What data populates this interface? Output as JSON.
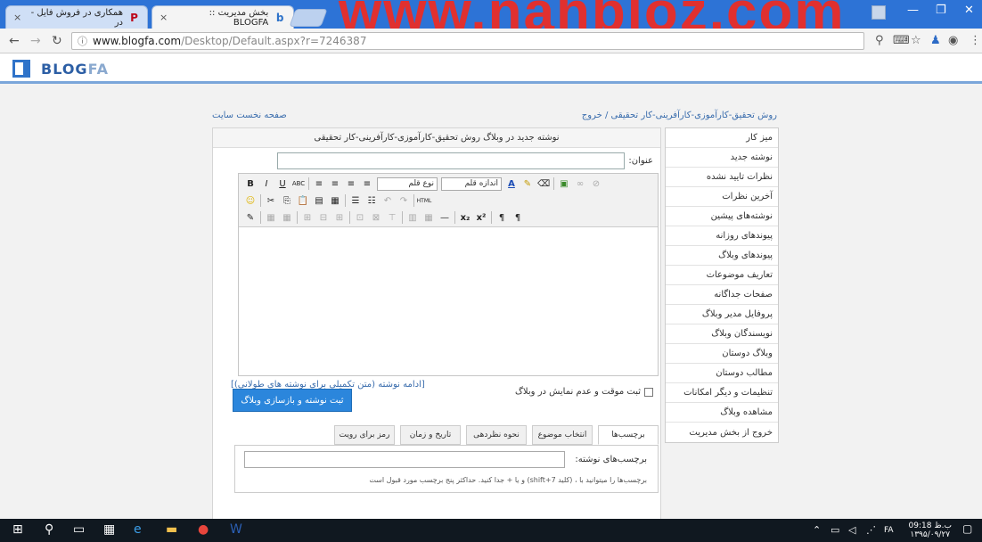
{
  "browser": {
    "tabs": [
      {
        "title": "همکاری در فروش فایل - در",
        "icon": "P"
      },
      {
        "title": "بخش مدیریت :: BLOGFA",
        "icon": "b"
      }
    ],
    "close_symbol": "×",
    "watermark": "www.nahbloz.com",
    "url_host": "www.blogfa.com",
    "url_path": "/Desktop/Default.aspx?r=7246387"
  },
  "brand": {
    "logo_main": "BLOG",
    "logo_accent": "FA"
  },
  "breadcrumb": {
    "left": "صفحه نخست سایت",
    "right": "روش تحقیق-کارآموزی-کارآفرینی-کار تحقیقی / خروج"
  },
  "editor": {
    "panel_title": "نوشته جدید در وبلاگ روش تحقیق-کارآموزی-کارآفرینی-کار تحقیقی",
    "title_label": "عنوان:",
    "font_select": "نوع قلم",
    "size_select": "اندازه قلم",
    "more_link": "[ادامه نوشته (متن تکمیلی برای نوشته های طولانی)]",
    "draft_label": "ثبت موقت و عدم نمایش در وبلاگ",
    "submit_label": "ثبت نوشته و بازسازی وبلاگ",
    "tabs": [
      "برچسب‌ها",
      "انتخاب موضوع",
      "نحوه نظردهی",
      "تاریخ و زمان",
      "رمز برای رویت"
    ],
    "tags_label": "برچسب‌های نوشته:",
    "tags_hint": "برچسب‌ها را میتوانید با ، (کلید shift+7) و یا + جدا کنید. حداکثر پنج برچسب مورد قبول است"
  },
  "menu": [
    "میز کار",
    "نوشته جدید",
    "نظرات تایید نشده",
    "آخرین نظرات",
    "نوشته‌های پیشین",
    "پیوندهای روزانه",
    "پیوندهای وبلاگ",
    "تعاریف موضوعات",
    "صفحات جداگانه",
    "پروفایل مدیر وبلاگ",
    "نویسندگان وبلاگ",
    "وبلاگ دوستان",
    "مطالب دوستان",
    "تنظیمات و دیگر امکانات",
    "مشاهده وبلاگ",
    "خروج از بخش مدیریت"
  ],
  "taskbar": {
    "time": "09:18 ب.ظ",
    "date": "۱۳۹۵/۰۹/۲۷",
    "lang": "FA"
  }
}
